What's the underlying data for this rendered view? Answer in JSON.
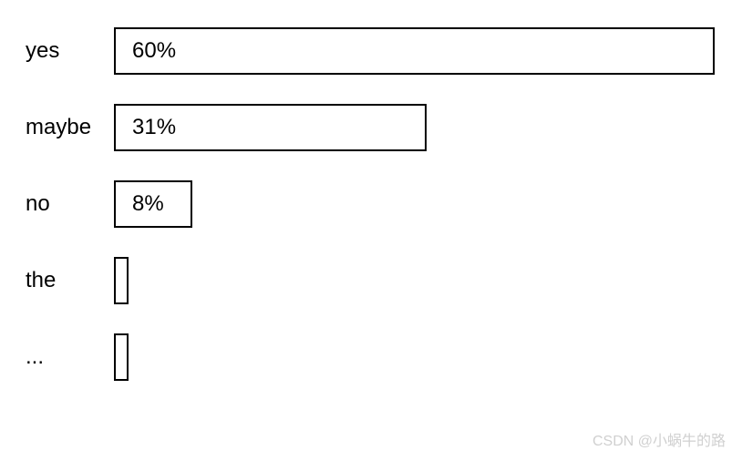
{
  "chart_data": {
    "type": "bar",
    "orientation": "horizontal",
    "categories": [
      "yes",
      "maybe",
      "no",
      "the",
      "..."
    ],
    "values": [
      60,
      31,
      8,
      1,
      1
    ],
    "value_labels": [
      "60%",
      "31%",
      "8%",
      "",
      ""
    ],
    "title": "",
    "xlabel": "",
    "ylabel": "",
    "xlim": [
      0,
      100
    ]
  },
  "rows": [
    {
      "label": "yes",
      "value": 60,
      "display": "60%",
      "width_pct": 100
    },
    {
      "label": "maybe",
      "value": 31,
      "display": "31%",
      "width_pct": 52
    },
    {
      "label": "no",
      "value": 8,
      "display": "8%",
      "width_pct": 13
    },
    {
      "label": "the",
      "value": 1,
      "display": "",
      "width_pct": 2.5,
      "thin": true
    },
    {
      "label": "...",
      "value": 1,
      "display": "",
      "width_pct": 2.5,
      "thin": true
    }
  ],
  "watermark": "CSDN @小蜗牛的路"
}
